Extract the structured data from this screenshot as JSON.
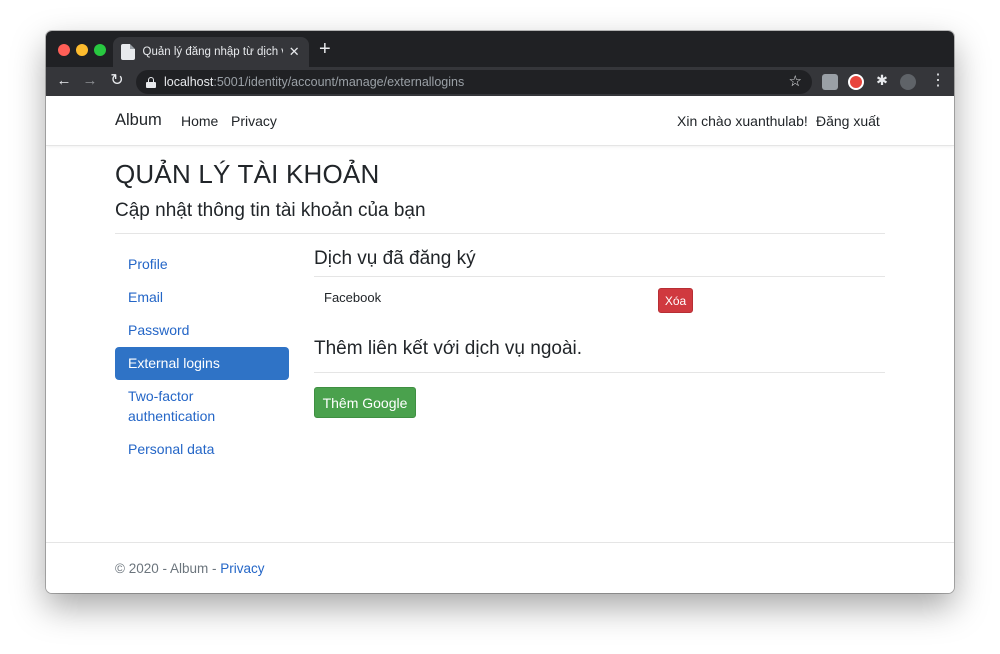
{
  "browser": {
    "tab_title": "Quản lý đăng nhập từ dịch vụ n",
    "tab_close": "✕",
    "new_tab": "+",
    "back": "←",
    "forward": "→",
    "reload": "↻",
    "url_host": "localhost",
    "url_rest": ":5001/identity/account/manage/externallogins",
    "star": "☆",
    "menu": "⋮"
  },
  "navbar": {
    "brand": "Album",
    "home": "Home",
    "privacy": "Privacy",
    "greeting": "Xin chào xuanthulab!",
    "logout": "Đăng xuất"
  },
  "header": {
    "title": "QUẢN LÝ TÀI KHOẢN",
    "subtitle": "Cập nhật thông tin tài khoản của bạn"
  },
  "sidebar": {
    "items": [
      {
        "label": "Profile",
        "active": false
      },
      {
        "label": "Email",
        "active": false
      },
      {
        "label": "Password",
        "active": false
      },
      {
        "label": "External logins",
        "active": true
      },
      {
        "label": "Two-factor authentication",
        "active": false
      },
      {
        "label": "Personal data",
        "active": false
      }
    ]
  },
  "main": {
    "registered_heading": "Dịch vụ đã đăng ký",
    "logins": [
      {
        "provider": "Facebook",
        "remove_label": "Xóa"
      }
    ],
    "add_heading": "Thêm liên kết với dịch vụ ngoài.",
    "add_google_label": "Thêm Google"
  },
  "footer": {
    "text": "© 2020 - Album - ",
    "privacy": "Privacy"
  },
  "colors": {
    "link": "#2466c7",
    "active": "#2f73c6",
    "danger": "#d0393f",
    "success": "#4aa14d"
  }
}
